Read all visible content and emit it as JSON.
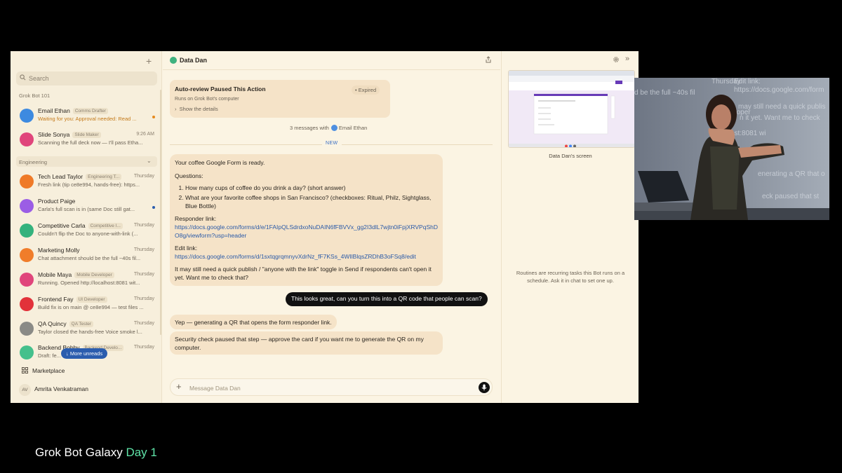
{
  "sidebar": {
    "search_placeholder": "Search",
    "group1_label": "Grok Bot 101",
    "group2_label": "Engineering",
    "items_top": [
      {
        "name": "Email Ethan",
        "tag": "Comms Drafter",
        "preview": "Waiting for you: Approval needed: Read ...",
        "time": "",
        "color": "#3d8ae0"
      },
      {
        "name": "Slide Sonya",
        "tag": "Slide Maker",
        "preview": "Scanning the full deck now — I'll pass Etha...",
        "time": "9:26 AM",
        "color": "#e0457b"
      }
    ],
    "items_eng": [
      {
        "name": "Tech Lead Taylor",
        "tag": "Engineering T...",
        "preview": "Fresh link (tip ce8e994, hands-free): https...",
        "time": "Thursday",
        "color": "#ef7a27"
      },
      {
        "name": "Product Paige",
        "tag": "",
        "preview": "Carla's full scan is in (same Doc still gat...",
        "time": "",
        "color": "#9b5de5"
      },
      {
        "name": "Competitive Carla",
        "tag": "Competitive I...",
        "preview": "Couldn't flip the Doc to anyone-with-link (...",
        "time": "Thursday",
        "color": "#34b27d"
      },
      {
        "name": "Marketing Molly",
        "tag": "",
        "preview": "Chat attachment should be the full ~40s fil...",
        "time": "Thursday",
        "color": "#f07d2a"
      },
      {
        "name": "Mobile Maya",
        "tag": "Mobile Developer",
        "preview": "Running. Opened http://localhost:8081 wit...",
        "time": "Thursday",
        "color": "#e0457b"
      },
      {
        "name": "Frontend Fay",
        "tag": "UI Developer",
        "preview": "Build fix is on main @ ce8e994 — test files ...",
        "time": "Thursday",
        "color": "#e2323a"
      },
      {
        "name": "QA Quincy",
        "tag": "QA Tester",
        "preview": "Taylor closed the hands-free Voice smoke l...",
        "time": "Thursday",
        "color": "#8a8a86"
      },
      {
        "name": "Backend Bobby",
        "tag": "Backend Develo...",
        "preview": "Draft: fe...",
        "time": "Thursday",
        "color": "#45c08c"
      }
    ],
    "more_unreads": "More unreads",
    "marketplace": "Marketplace",
    "user_initials": "AV",
    "user_name": "Amrita Venkatraman"
  },
  "chat": {
    "title": "Data Dan",
    "card_title": "Auto-review Paused This Action",
    "card_sub": "Runs on Grok Bot's computer",
    "card_details": "Show the details",
    "card_status": "Expired",
    "three_messages": "3 messages with",
    "three_with": "Email Ethan",
    "new_label": "NEW",
    "b1_intro": "Your coffee Google Form is ready.",
    "b1_questions": "Questions:",
    "b1_q1": "How many cups of coffee do you drink a day? (short answer)",
    "b1_q2": "What are your favorite coffee shops in San Francisco? (checkboxes: Ritual, Philz, Sightglass, Blue Bottle)",
    "b1_responder_label": "Responder link:",
    "b1_responder_url": "https://docs.google.com/forms/d/e/1FAIpQLSdrdxoNuDAIN6fFBVVx_gg2I3dlL7wjtn0iFpjXRVPqShDO8g/viewform?usp=header",
    "b1_edit_label": "Edit link:",
    "b1_edit_url": "https://docs.google.com/forms/d/1sxtqgrqmnyvXdrNz_fF7KSs_4WIlBlqsZRDhB3oFSq8/edit",
    "b1_note": "It may still need a quick publish / \"anyone with the link\" toggle in Send if respondents can't open it yet. Want me to check that?",
    "user_message": "This looks great, can you turn this into a QR code that people can scan?",
    "b2": "Yep — generating a QR that opens the form responder link.",
    "b3": "Security check paused that step — approve the card if you want me to generate the QR on my computer.",
    "composer_placeholder": "Message Data Dan"
  },
  "right": {
    "screen_caption": "Data Dan's screen",
    "routines": "Routines are recurring tasks this Bot runs on a schedule. Ask it in chat to set one up."
  },
  "footer": {
    "title": "Grok Bot Galaxy",
    "day": "Day 1"
  },
  "video": {
    "screen_text": [
      "Thursday",
      "Edit link:",
      "https://docs.google.com/form",
      "d be the full ~40s fil",
      "may still need a quick publis",
      "n it yet. Want me to check",
      "Developer",
      "/localhost:8081 wi",
      "ce8e994 — test",
      "enerating a QR that o",
      "eck paused that st"
    ]
  }
}
